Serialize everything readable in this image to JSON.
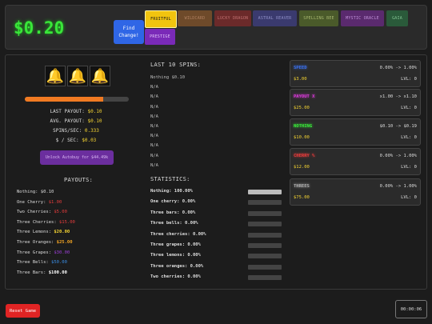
{
  "header": {
    "money": "$0.20",
    "find_change": "Find\nChange!",
    "tabs": [
      {
        "label": "FRUITFUL",
        "bg": "#f1c40f",
        "fg": "#1a1a1a"
      },
      {
        "label": "WILDCARD",
        "bg": "#6e4a2a",
        "fg": "#b08060"
      },
      {
        "label": "LUCKY DRAGON",
        "bg": "#6b2a2a",
        "fg": "#c07070"
      },
      {
        "label": "ASTRAL REAVER",
        "bg": "#3a3a6e",
        "fg": "#9090c8"
      },
      {
        "label": "SPELLING BEE",
        "bg": "#4a5a2a",
        "fg": "#a8b870"
      },
      {
        "label": "MYSTIC ORACLE",
        "bg": "#5a2a6e",
        "fg": "#c090d8"
      },
      {
        "label": "GAIA",
        "bg": "#2a5a3a",
        "fg": "#80c090"
      },
      {
        "label": "PRESTIGE",
        "bg": "#7a2ab8",
        "fg": "#e0c0f8"
      }
    ]
  },
  "slots": {
    "reels": [
      "🔔",
      "🔔",
      "🔔"
    ],
    "progress": 0.75
  },
  "stats_left": {
    "last_payout_label": "LAST PAYOUT:",
    "last_payout": "$0.10",
    "avg_payout_label": "AVG. PAYOUT:",
    "avg_payout": "$0.10",
    "spins_sec_label": "SPINS/SEC:",
    "spins_sec": "0.333",
    "per_sec_label": "$ / SEC:",
    "per_sec": "$0.03",
    "autobuy": "Unlock Autobuy for $44.49k"
  },
  "payouts": {
    "title": "PAYOUTS:",
    "items": [
      {
        "name": "Nothing:",
        "value": "$0.10",
        "color": "#dddddd"
      },
      {
        "name": "One Cherry:",
        "value": "$1.00",
        "color": "#e63c3c"
      },
      {
        "name": "Two Cherries:",
        "value": "$5.00",
        "color": "#e63c3c"
      },
      {
        "name": "Three Cherries:",
        "value": "$15.00",
        "color": "#e63c3c"
      },
      {
        "name": "Three Lemons:",
        "value": "$20.00",
        "color": "#f5d432"
      },
      {
        "name": "Three Oranges:",
        "value": "$25.00",
        "color": "#f5a623"
      },
      {
        "name": "Three Grapes:",
        "value": "$30.00",
        "color": "#9b3fd6"
      },
      {
        "name": "Three Bells:",
        "value": "$50.00",
        "color": "#3a8ee6"
      },
      {
        "name": "Three Bars:",
        "value": "$100.00",
        "color": "#ffffff"
      }
    ]
  },
  "spins": {
    "title": "LAST 10 SPINS:",
    "items": [
      "Nothing $0.10",
      "N/A",
      "N/A",
      "N/A",
      "N/A",
      "N/A",
      "N/A",
      "N/A",
      "N/A",
      "N/A"
    ]
  },
  "statistics": {
    "title": "STATISTICS:",
    "items": [
      {
        "label": "Nothing: 100.00%",
        "value": 1.0
      },
      {
        "label": "One cherry: 0.00%",
        "value": 0
      },
      {
        "label": "Three bars: 0.00%",
        "value": 0
      },
      {
        "label": "Three bells: 0.00%",
        "value": 0
      },
      {
        "label": "Three cherries: 0.00%",
        "value": 0
      },
      {
        "label": "Three grapes: 0.00%",
        "value": 0
      },
      {
        "label": "Three lemons: 0.00%",
        "value": 0
      },
      {
        "label": "Three oranges: 0.00%",
        "value": 0
      },
      {
        "label": "Two cherries: 0.00%",
        "value": 0
      }
    ]
  },
  "upgrades": [
    {
      "name": "SPEED",
      "color": "#3a6ee6",
      "mult": "0.00% -> 1.00%",
      "cost": "$3.00",
      "level": "LVL: 0"
    },
    {
      "name": "PAYOUT X",
      "color": "#d63ad6",
      "mult": "x1.00 -> x1.10",
      "cost": "$25.00",
      "level": "LVL: 0"
    },
    {
      "name": "NOTHING",
      "color": "#39e639",
      "mult": "$0.10 -> $0.19",
      "cost": "$10.00",
      "level": "LVL: 0"
    },
    {
      "name": "CHERRY %",
      "color": "#e63c3c",
      "mult": "0.00% -> 1.00%",
      "cost": "$12.00",
      "level": "LVL: 0"
    },
    {
      "name": "THREES",
      "color": "#aaaaaa",
      "mult": "0.00% -> 1.00%",
      "cost": "$75.00",
      "level": "LVL: 0"
    }
  ],
  "footer": {
    "reset": "Reset Game",
    "timer": "00:00:06"
  }
}
